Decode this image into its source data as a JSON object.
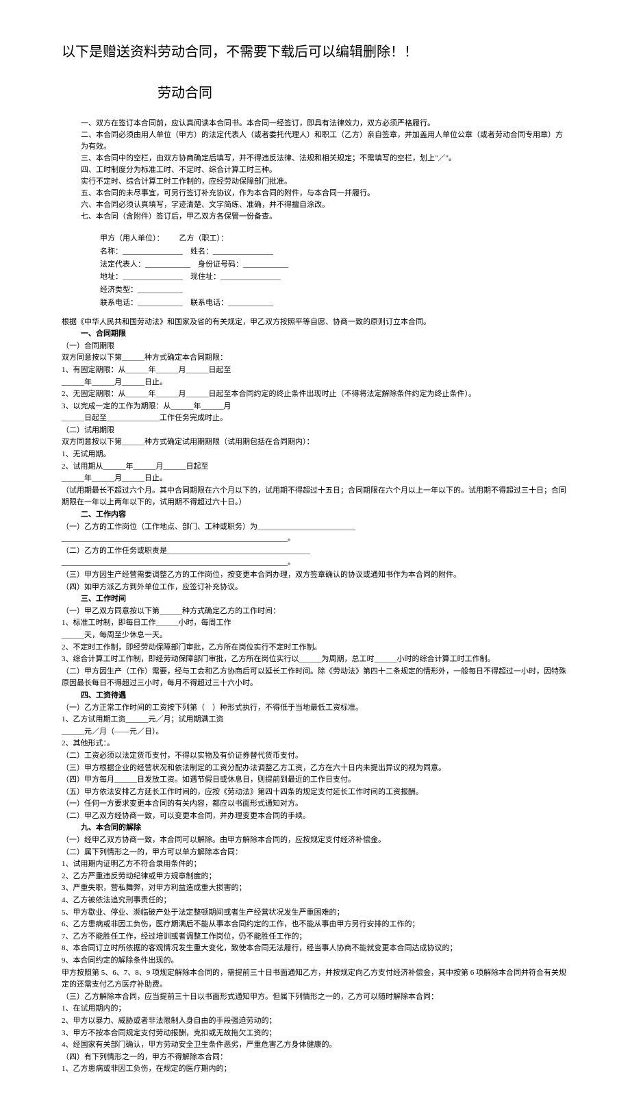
{
  "bonusTitle": "以下是赠送资料劳动合同，不需要下载后可以编辑删除！！",
  "mainTitle": "劳动合同",
  "intro": [
    "一、双方在签订本合同前，应认真阅读本合同书。本合同一经签订，即具有法律效力，双方必须严格履行。",
    "二、本合同必须由用人单位（甲方）的法定代表人（或者委托代理人）和职工（乙方）亲自签章，并加盖用人单位公章（或者劳动合同专用章）方为有效。",
    "三、本合同中的空栏，由双方协商确定后填写，并不得违反法律、法规和相关规定；不需填写的空栏，划上\"／\"。",
    "四、工时制度分为标准工时、不定时、综合计算工时三种。",
    "实行不定时、综合计算工时工作制的，应经劳动保障部门批准。",
    "五、本合同的未尽事宜，可另行签订补充协议，作为本合同的附件，与本合同一并履行。",
    "六、本合同必须认真填写，字迹清楚、文字简练、准确，并不得擅自涂改。",
    "七、本合同（含附件）签订后，甲乙双方各保管一份备查。"
  ],
  "parties": {
    "row1a": "甲方（用人单位）：",
    "row1b": "乙方（职工）：",
    "row2a": "名称：________________",
    "row2b": "姓名：________________",
    "row3a": "法定代表人：____________",
    "row3b": "身份证号码：____________",
    "row4a": "地址：________________",
    "row4b": "现住址：________________",
    "row5a": "经济类型：____________",
    "row6a": "联系电话：____________",
    "row6b": "联系电话：____________"
  },
  "preamble": "根据《中华人民共和国劳动法》和国家及省的有关规定，甲乙双方按照平等自愿、协商一致的原则订立本合同。",
  "s1": {
    "head": "一、合同期限",
    "sub1": "（一）合同期限",
    "l1": "双方同意按以下第______种方式确定本合同期限：",
    "l2": "1、有固定期限：从______年______月______日起至",
    "l3": "______年______月______日止。",
    "l4": "2、无固定期限：从______年______月______日起至本合同约定的终止条件出现时止（不得将法定解除条件约定为终止条件）。",
    "l5": "3、以完成一定的工作为期限：从______年______月",
    "l6": "______日起至______________工作任务完成时止。",
    "sub2": "（二）试用期限",
    "l7": "双方同意按以下第______种方式确定试用期期限（试用期包括在合同期内）：",
    "l8": "1、无试用期。",
    "l9": "2、试用期从______年______月______日起至",
    "l10": "______年______月______日止。",
    "l11": "（试用期最长不超过六个月。其中合同期限在六个月以下的，试用期不得超过十五日；合同期限在六个月以上一年以下的。试用期不得超过三十日；合同期限在一年以上两年以下的，试用期不得超过六十日。）"
  },
  "s2": {
    "head": "二、工作内容",
    "l1": "（一）乙方的工作岗位（工作地点、部门、工种或职务）为__________________________",
    "l2": "____________________________________________________________。",
    "l3": "（二）乙方的工作任务或职责是______________________________________",
    "l4": "____________________________________________________________。",
    "l5": "（三）甲方因生产经营需要调整乙方的工作岗位，按变更本合同办理，双方签章确认的协议或通知书作为本合同的附件。",
    "l6": "（四）如甲方派乙方到外单位工作，应签订补充协议。"
  },
  "s3": {
    "head": "三、工作时间",
    "l1": "（一）甲乙双方同意按以下第______种方式确定乙方的工作时间：",
    "l2": "1、标准工时制，即每日工作______小时，每周工作",
    "l3": "______天，每周至少休息一天。",
    "l4": "2、不定时工作制，即经劳动保障部门审批，乙方所在岗位实行不定时工作制。",
    "l5": "3、综合计算工时工作制，即经劳动保障部门审批，乙方所在岗位实行以______为周期，总工时______小时的综合计算工时工作制。",
    "l6": "（二）甲方因生产（工作）需要，经与工会和乙方协商后可以延长工作时间。除《劳动法》第四十二条规定的情形外，一般每日不得超过一小时，因特殊原因最长每日不得超过三小时，每月不得超过三十六小时。"
  },
  "s4": {
    "head": "四、工资待遇",
    "l1": "（一）乙方正常工作时间的工资按下列第（　）种形式执行，不得低于当地最低工资标准。",
    "l2": "1、乙方试用期工资______元／月；试用期满工资",
    "l3": "______元／月（——元／日）。",
    "l4": "2、其他形式：。",
    "l5": "（二）工资必须以法定货币支付，不得以实物及有价证券替代货币支付。",
    "l6": "（三）甲方根据企业的经营状况和依法制定的工资分配办法调整乙方工资，乙方在六十日内未提出异议的视为同意。",
    "l7": "（四）甲方每月______日发放工资。如遇节假日或休息日，则提前到最近的工作日支付。",
    "l8": "（五）甲方依法安排乙方延长工作时间的，应按《劳动法》第四十四条的规定支付延长工作时间的工资报酬。",
    "l9": "（一）任何一方要求变更本合同的有关内容，都应以书面形式通知对方。",
    "l10": "（二）甲乙双方经协商一致，可以变更本合同，并办理变更本合同的手续。"
  },
  "s9": {
    "head": "九、本合同的解除",
    "l1": "（一）经甲乙双方协商一致，本合同可以解除。由甲方解除本合同的，应按规定支付经济补偿金。",
    "l2": "（二）属下列情形之一的，甲方可以单方解除本合同：",
    "i1": "1、试用期内证明乙方不符合录用条件的；",
    "i2": "2、乙方严重违反劳动纪律或甲方规章制度的；",
    "i3": "3、严重失职，营私舞弊，对甲方利益造成重大损害的；",
    "i4": "4、乙方被依法追究刑事责任的；",
    "i5": "5、甲方歇业、停业、濒临破产处于法定整顿期间或者生产经营状况发生严重困难的；",
    "i6": "6、乙方患病或非因工负伤，医疗期满后不能从事本合同约定的工作，也不能从事由甲方另行安排的工作的；",
    "i7": "7、乙方不能胜任工作，经过培训或者调整工作岗位，仍不能胜任工作的；",
    "i8": "8、本合同订立时所依据的客观情况发生重大变化，致使本合同无法履行，经当事人协商不能就变更本合同达成协议的；",
    "i9": "9、本合同约定的解除条件出现的。",
    "l3": "甲方按照第 5、6、7、8、9 项规定解除本合同的，需提前三十日书面通知乙方，并按规定向乙方支付经济补偿金，其中按第 6 项解除本合同并符合有关规定的还需支付乙方医疗补助费。",
    "l4": "（三）乙方解除本合同，应当提前三十日以书面形式通知甲方。但属下列情形之一的，乙方可以随时解除本合同：",
    "j1": "1、在试用期内的；",
    "j2": "2、甲方以暴力、威胁或者非法限制人身自由的手段强迫劳动的；",
    "j3": "3、甲方不按本合同规定支付劳动报酬，克扣或无故拖欠工资的；",
    "j4": "4、经国家有关部门确认，甲方劳动安全卫生条件恶劣，严重危害乙方身体健康的。",
    "l5": "（四）有下列情形之一的，甲方不得解除本合同：",
    "k1": "1、乙方患病或非因工负伤，在规定的医疗期内的；"
  }
}
